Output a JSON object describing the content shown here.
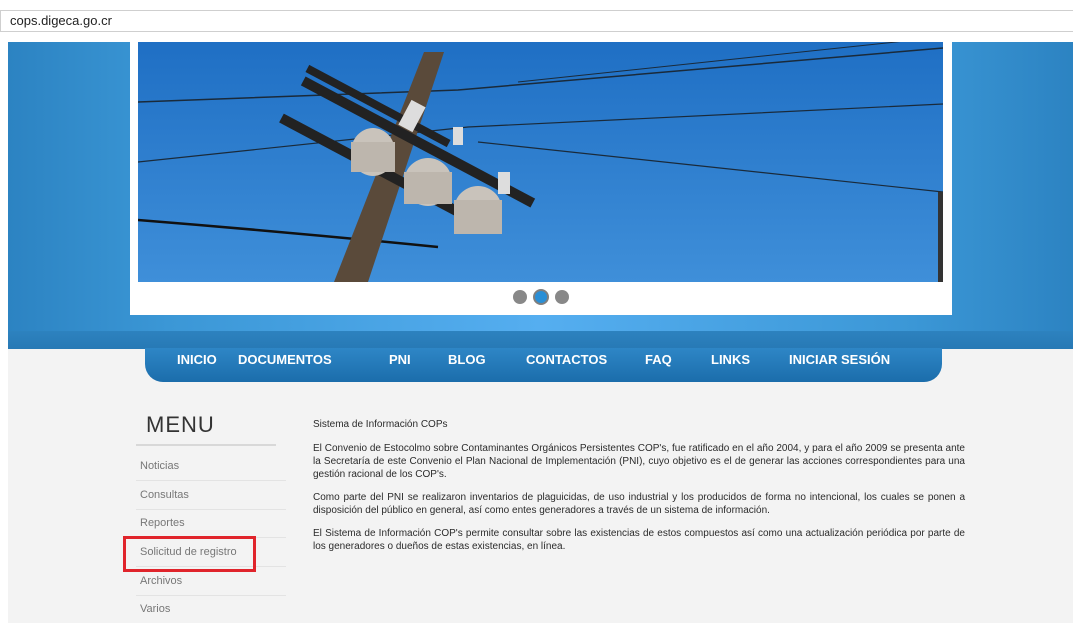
{
  "browser": {
    "url": "cops.digeca.go.cr"
  },
  "slider": {
    "dots": 3,
    "active_dot": 2
  },
  "nav": {
    "items": [
      "INICIO",
      "DOCUMENTOS",
      "PNI",
      "BLOG",
      "CONTACTOS",
      "FAQ",
      "LINKS",
      "INICIAR SESIÓN"
    ]
  },
  "sidebar": {
    "title": "MENU",
    "items": [
      "Noticias",
      "Consultas",
      "Reportes",
      "Solicitud de registro",
      "Archivos",
      "Varios"
    ]
  },
  "content": {
    "title": "Sistema de Información COPs",
    "paragraphs": [
      "El Convenio de Estocolmo sobre Contaminantes Orgánicos Persistentes COP's, fue ratificado en el año 2004, y para el año 2009 se presenta ante la Secretaría de este Convenio el Plan Nacional de Implementación (PNI), cuyo objetivo es el de generar las acciones correspondientes para una gestión racional de los COP's.",
      "Como parte del PNI se realizaron inventarios de plaguicidas, de uso industrial y los producidos de forma no intencional, los cuales se ponen a disposición del público en general, así como entes generadores a través de un sistema de información.",
      "El Sistema de Información COP's permite consultar sobre las existencias de estos compuestos así como una actualización periódica por parte de los generadores o dueños de estas existencias, en línea."
    ]
  },
  "colors": {
    "nav_blue": "#1b6dab",
    "highlight_red": "#e0242b",
    "sky": "#2f7fd3"
  }
}
